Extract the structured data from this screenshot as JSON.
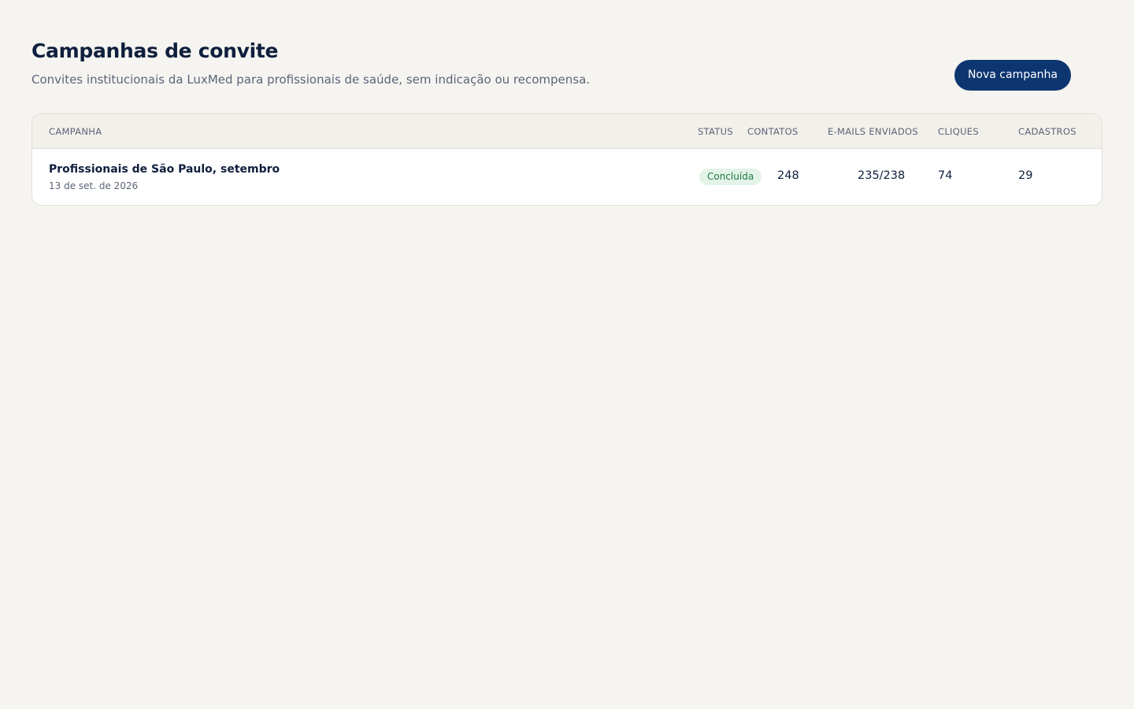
{
  "header": {
    "title": "Campanhas de convite",
    "subtitle": "Convites institucionais da LuxMed para profissionais de saúde, sem indicação ou recompensa.",
    "new_button_label": "Nova campanha"
  },
  "table": {
    "columns": {
      "campaign": "CAMPANHA",
      "status": "STATUS",
      "contacts": "CONTATOS",
      "emails_sent": "E-MAILS ENVIADOS",
      "clicks": "CLIQUES",
      "signups": "CADASTROS"
    },
    "rows": [
      {
        "name": "Profissionais de São Paulo, setembro",
        "date": "13 de set. de 2026",
        "status": "Concluída",
        "contacts": "248",
        "emails_sent": "235/238",
        "clicks": "74",
        "signups": "29"
      }
    ]
  },
  "colors": {
    "background": "#f5f4f0",
    "primary_button": "#0d3670",
    "status_done_bg": "#e3f3e8",
    "status_done_text": "#1f7a45"
  }
}
